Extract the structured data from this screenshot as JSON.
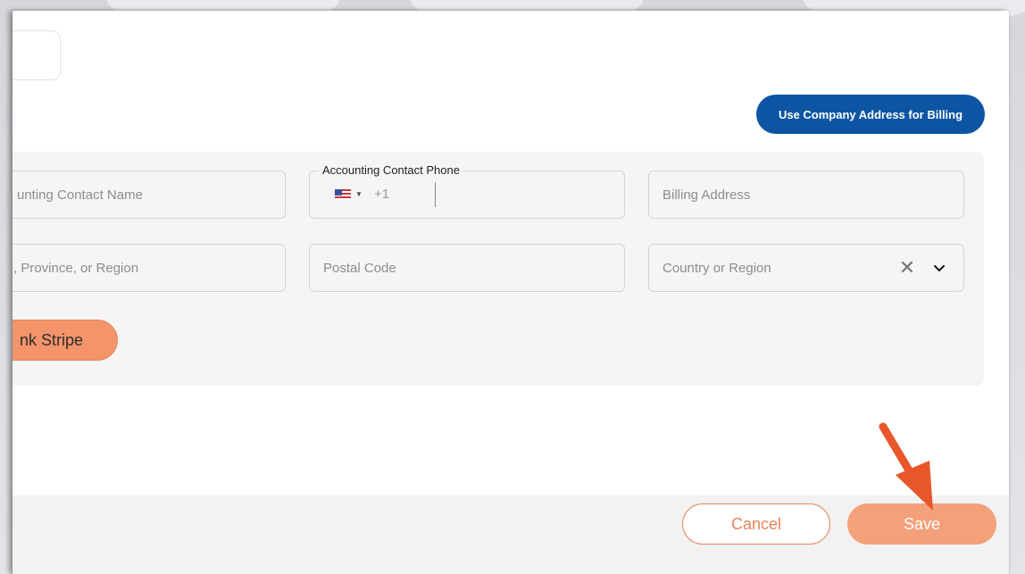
{
  "billing": {
    "use_company_address_label": "Use Company Address for Billing",
    "fields": {
      "contact_name_placeholder": "unting Contact Name",
      "contact_phone_label": "Accounting Contact Phone",
      "phone_dial_code": "+1",
      "billing_address_placeholder": "Billing Address",
      "state_placeholder": ", Province, or Region",
      "postal_code_placeholder": "Postal Code",
      "country_placeholder": "Country or Region"
    },
    "link_stripe_label": "nk Stripe"
  },
  "footer": {
    "cancel_label": "Cancel",
    "save_label": "Save"
  },
  "icons": {
    "flag": "us-flag-icon",
    "clear": "close-icon",
    "chevron": "chevron-down-icon",
    "annotation": "arrow-annotation-icon"
  },
  "colors": {
    "primary_blue": "#0d55a3",
    "accent_orange": "#f4946a",
    "save_orange": "#f4a07a",
    "arrow_orange": "#e8572a"
  }
}
